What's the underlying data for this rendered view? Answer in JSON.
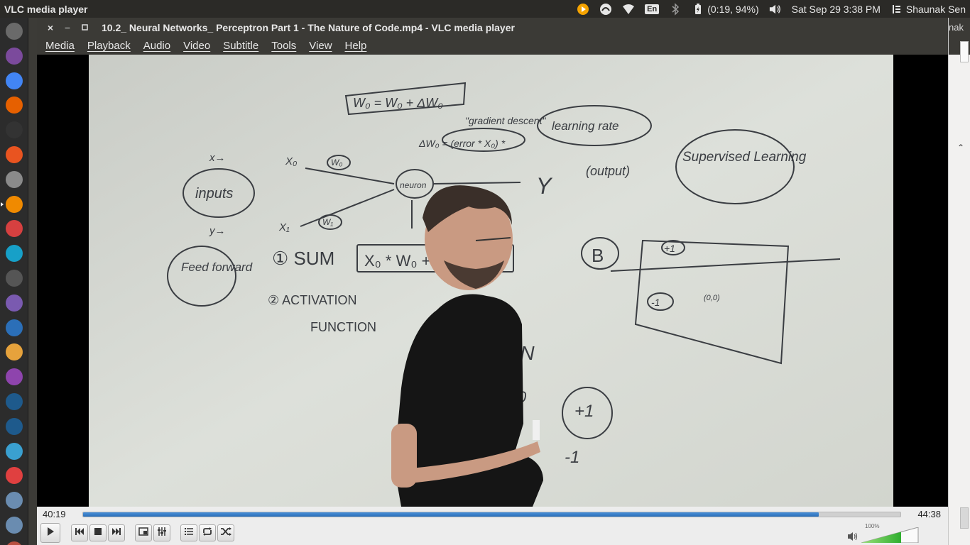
{
  "top_panel": {
    "app_title": "VLC media player",
    "battery": "(0:19, 94%)",
    "keyboard": "En",
    "datetime": "Sat Sep 29  3:38 PM",
    "user": "Shaunak Sen",
    "icons": [
      "vlc-tray-icon",
      "sync-icon",
      "wifi-icon",
      "keyboard-icon",
      "bluetooth-icon",
      "battery-icon",
      "volume-icon",
      "session-icon"
    ]
  },
  "launcher": {
    "items": [
      {
        "name": "dash-icon",
        "color": "#6a6a6a"
      },
      {
        "name": "files-icon",
        "color": "#7b4a9c"
      },
      {
        "name": "chrome-icon",
        "color": "#4285f4"
      },
      {
        "name": "firefox-icon",
        "color": "#e66000"
      },
      {
        "name": "terminal-icon",
        "color": "#333333"
      },
      {
        "name": "software-center-icon",
        "color": "#e95420"
      },
      {
        "name": "settings-icon",
        "color": "#8a8a8a"
      },
      {
        "name": "vlc-icon",
        "color": "#f08a00"
      },
      {
        "name": "app-red-icon",
        "color": "#d64040"
      },
      {
        "name": "webstorm-icon",
        "color": "#17a0c8"
      },
      {
        "name": "disk-icon",
        "color": "#555555"
      },
      {
        "name": "atom-icon",
        "color": "#7a5ab0"
      },
      {
        "name": "r-icon",
        "color": "#2b6fb8"
      },
      {
        "name": "weather-icon",
        "color": "#e6a23c"
      },
      {
        "name": "document-viewer-icon",
        "color": "#8e44ad"
      },
      {
        "name": "pycharm-icon",
        "color": "#1e5a8c"
      },
      {
        "name": "pycharm-edu-icon",
        "color": "#1e5a8c"
      },
      {
        "name": "calculator-icon",
        "color": "#3aa0d0"
      },
      {
        "name": "chart-app-icon",
        "color": "#e04040"
      },
      {
        "name": "usb-icon",
        "color": "#6a8cb0"
      },
      {
        "name": "usb-icon-2",
        "color": "#6a8cb0"
      },
      {
        "name": "trash-icon",
        "color": "#b85040"
      }
    ]
  },
  "window": {
    "title": "10.2_ Neural Networks_ Perceptron Part 1 - The Nature of Code.mp4 - VLC media player",
    "close": "×",
    "minimize": "−",
    "maximize": "▫",
    "menus": [
      "Media",
      "Playback",
      "Audio",
      "Video",
      "Subtitle",
      "Tools",
      "View",
      "Help"
    ]
  },
  "whiteboard": {
    "formula_top": "W₀ = W₀ + ΔW₀",
    "gradient_descent": "\"gradient descent\"",
    "delta_w": "ΔW₀ = (error * X₀) *",
    "learning_rate": "learning rate",
    "x_arrow": "x→",
    "y_arrow": "y→",
    "inputs": "inputs",
    "x0": "X₀",
    "x1": "X₁",
    "w0": "W₀",
    "w1": "W₁",
    "neuron": "neuron",
    "y": "Y",
    "output": "(output)",
    "supervised": "Supervised Learning",
    "feed_forward": "Feed forward",
    "sum": "① SUM",
    "sum_box": "X₀ * W₀ +",
    "activation": "② ACTIVATION",
    "function": "FUNCTION",
    "b": "B",
    "plus_one": "+1",
    "minus_one": "-1",
    "origin": "(0,0)",
    "sign": "N (N",
    "gt0": "> 0",
    "plus_one_b": "+1",
    "minus_one_b": "-1"
  },
  "playback": {
    "elapsed": "40:19",
    "total": "44:38",
    "progress": 0.9
  },
  "controls": {
    "buttons": [
      "play-icon",
      "previous-icon",
      "stop-icon",
      "next-icon",
      "fullscreen-icon",
      "extended-settings-icon",
      "playlist-icon",
      "loop-icon",
      "shuffle-icon"
    ],
    "volume_label": "100%",
    "volume_level": 0.7
  },
  "right_strip": {
    "title_fragment": "nak"
  }
}
